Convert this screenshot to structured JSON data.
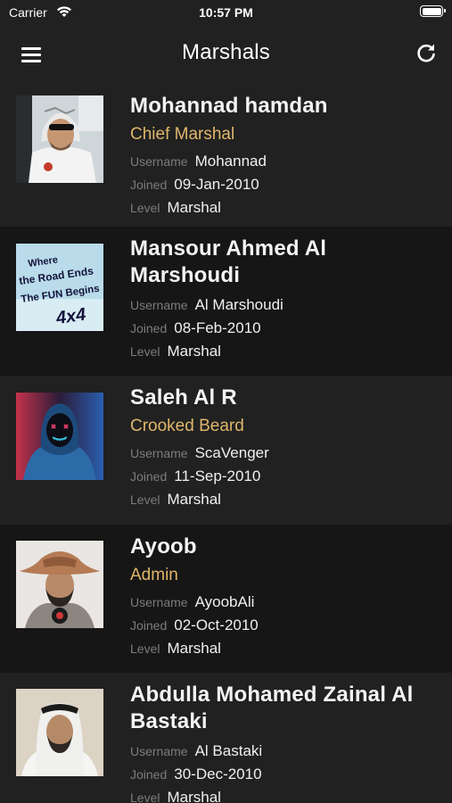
{
  "status_bar": {
    "carrier": "Carrier",
    "time": "10:57 PM"
  },
  "nav": {
    "title": "Marshals",
    "menu_icon": "hamburger-icon",
    "refresh_icon": "refresh-icon"
  },
  "labels": {
    "username": "Username",
    "joined": "Joined",
    "level": "Level"
  },
  "marshals": [
    {
      "name": "Mohannad hamdan",
      "role": "Chief Marshal",
      "username": "Mohannad",
      "joined": "09-Jan-2010",
      "level": "Marshal"
    },
    {
      "name": "Mansour Ahmed Al Marshoudi",
      "role": "",
      "username": "Al Marshoudi",
      "joined": "08-Feb-2010",
      "level": "Marshal"
    },
    {
      "name": "Saleh Al R",
      "role": "Crooked Beard",
      "username": "ScaVenger",
      "joined": "11-Sep-2010",
      "level": "Marshal"
    },
    {
      "name": "Ayoob",
      "role": "Admin",
      "username": "AyoobAli",
      "joined": "02-Oct-2010",
      "level": "Marshal"
    },
    {
      "name": "Abdulla Mohamed Zainal Al Bastaki",
      "role": "",
      "username": "Al Bastaki",
      "joined": "30-Dec-2010",
      "level": "Marshal"
    }
  ],
  "avatar_logo_text": [
    "Where",
    "the Road Ends",
    "The FUN Begins",
    "4x4"
  ],
  "colors": {
    "background": "#161616",
    "card_alt": "#212121",
    "role_accent": "#e0b66b",
    "label_gray": "#7c7c7c"
  }
}
